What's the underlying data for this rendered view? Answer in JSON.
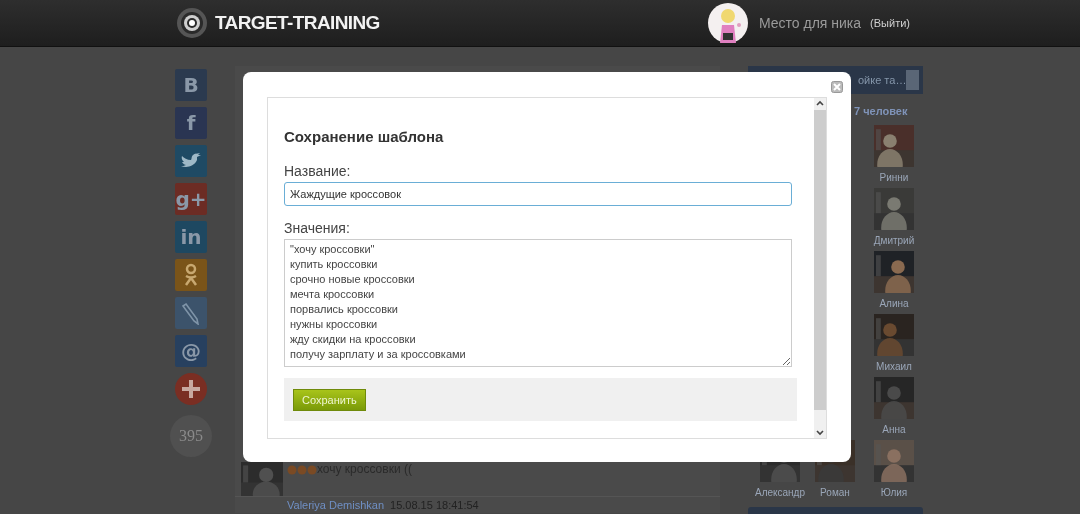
{
  "header": {
    "logo": "TARGET-TRAINING",
    "nickname": "Место для ника",
    "logout": "(Выйти)"
  },
  "social": {
    "buttons": [
      {
        "kind": "letter",
        "label": "В",
        "color": "#2b3a4f"
      },
      {
        "kind": "letter",
        "label": "f",
        "color": "#2a3552"
      },
      {
        "kind": "bird",
        "color": "#1f4a64"
      },
      {
        "kind": "letter",
        "label": "g+",
        "color": "#6c2c24"
      },
      {
        "kind": "letter",
        "label": "in",
        "color": "#1e4861"
      },
      {
        "kind": "ok",
        "color": "#7a5419"
      },
      {
        "kind": "pencil",
        "color": "#3c536b"
      },
      {
        "kind": "letter",
        "label": "@",
        "color": "#27405f"
      },
      {
        "kind": "plus",
        "color": "#7a2e23"
      }
    ],
    "counter": "395"
  },
  "feed": {
    "post": {
      "text": "хочу кроссовки (("
    },
    "next_author": "Valeriya Demishkan",
    "next_time": "15.08.15 18:41:54"
  },
  "group": {
    "title": "ойке та…",
    "members": "7 человек",
    "people": [
      {
        "name": "Ринни"
      },
      {
        "name": "Дмитрий"
      },
      {
        "name": "Алина"
      },
      {
        "name": "Михаил"
      },
      {
        "name": "Анна"
      },
      {
        "name": "Александр"
      },
      {
        "name": "Роман"
      },
      {
        "name": "Юлия"
      }
    ]
  },
  "dialog": {
    "title": "Сохранение шаблона",
    "name_label": "Название:",
    "name_value": "Жаждущие кроссовок",
    "values_label": "Значения:",
    "values": [
      "\"хочу кроссовки\"",
      "купить кроссовки",
      "срочно новые кроссовки",
      "мечта кроссовки",
      "порвались кроссовки",
      "нужны кроссовки",
      "жду скидки на кроссовки",
      "получу зарплату и за кроссовками"
    ],
    "save_button": "Сохранить"
  }
}
